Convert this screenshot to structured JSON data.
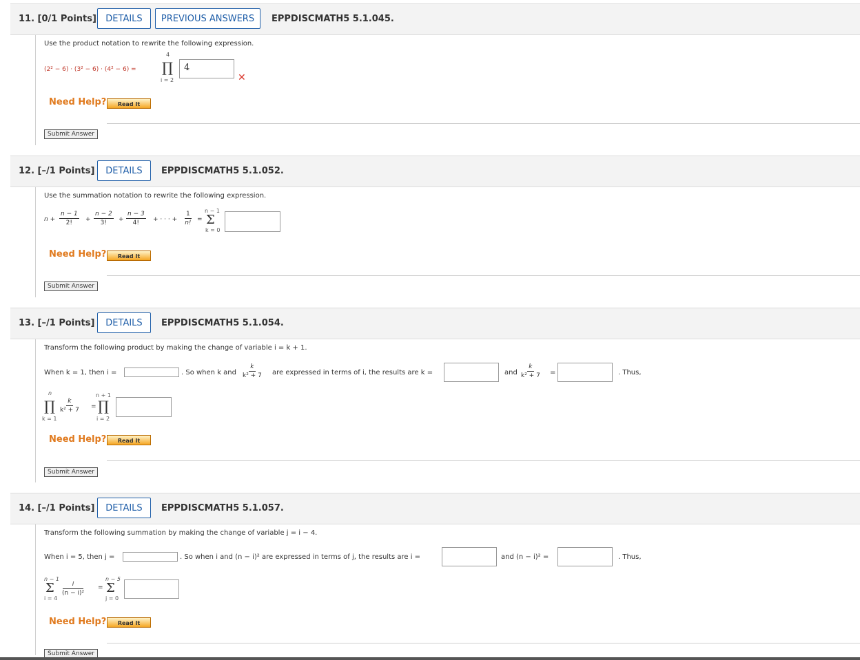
{
  "q11": {
    "number": "11. [0/1 Points]",
    "details": "DETAILS",
    "previous_answers": "PREVIOUS ANSWERS",
    "id": "EPPDISCMATH5 5.1.045.",
    "instruction": "Use the product notation to rewrite the following expression.",
    "expression": "(2² − 6) · (3² − 6) · (4² − 6) =",
    "upper": "4",
    "lower": "i = 2",
    "answer": "4",
    "status": "incorrect"
  },
  "q12": {
    "number": "12. [–/1 Points]",
    "details": "DETAILS",
    "id": "EPPDISCMATH5 5.1.052.",
    "instruction": "Use the summation notation to rewrite the following expression.",
    "lead": "n +",
    "terms": [
      {
        "num": "n − 1",
        "den": "2!"
      },
      {
        "num": "n − 2",
        "den": "3!"
      },
      {
        "num": "n − 3",
        "den": "4!"
      },
      {
        "num": "1",
        "den": "n!"
      }
    ],
    "plus": "+",
    "dots": "+ · · · +",
    "equals": "=",
    "upper": "n − 1",
    "lower": "k = 0"
  },
  "q13": {
    "number": "13. [–/1 Points]",
    "details": "DETAILS",
    "id": "EPPDISCMATH5 5.1.054.",
    "instruction": "Transform the following product by making the change of variable i = k + 1.",
    "when": "When k = 1, then i =",
    "so_when": ". So when k and",
    "frac": {
      "num": "k",
      "den": "k² + 7"
    },
    "expressed": "are expressed in terms of i, the results are k =",
    "and": "and",
    "eq": "=",
    "thus": ". Thus,",
    "prod_upper": "n",
    "prod_lower": "k = 1",
    "prod2_upper": "n + 1",
    "prod2_lower": "i = 2"
  },
  "q14": {
    "number": "14. [–/1 Points]",
    "details": "DETAILS",
    "id": "EPPDISCMATH5 5.1.057.",
    "instruction": "Transform the following summation by making the change of variable j = i − 4.",
    "when": "When i = 5, then j =",
    "so_when": ". So when i and (n − i)² are expressed in terms of j, the results are i =",
    "and": "and (n − i)² =",
    "thus": ". Thus,",
    "sum_upper": "n − 1",
    "sum_lower": "i = 4",
    "frac": {
      "num": "i",
      "den": "(n − i)²"
    },
    "sum2_upper": "n − 5",
    "sum2_lower": "j = 0"
  },
  "common": {
    "need_help": "Need Help?",
    "read_it": "Read It",
    "submit": "Submit Answer"
  },
  "symbols": {
    "product": "∏",
    "sum": "Σ",
    "equals": "=",
    "wrong_mark": "✕"
  }
}
